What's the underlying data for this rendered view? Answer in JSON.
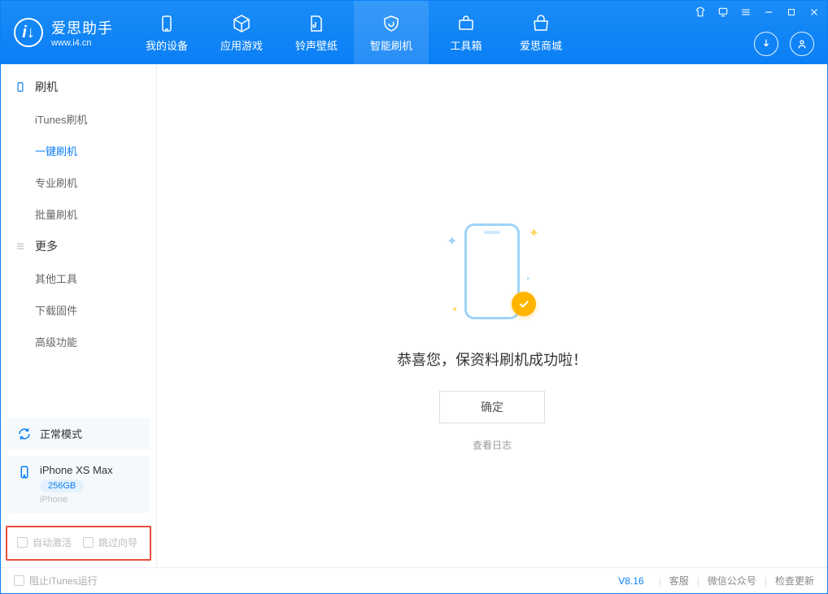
{
  "app": {
    "name": "爱思助手",
    "url": "www.i4.cn"
  },
  "topTabs": [
    {
      "label": "我的设备"
    },
    {
      "label": "应用游戏"
    },
    {
      "label": "铃声壁纸"
    },
    {
      "label": "智能刷机"
    },
    {
      "label": "工具箱"
    },
    {
      "label": "爱思商城"
    }
  ],
  "sidebar": {
    "group1": {
      "title": "刷机"
    },
    "items1": [
      {
        "label": "iTunes刷机"
      },
      {
        "label": "一键刷机"
      },
      {
        "label": "专业刷机"
      },
      {
        "label": "批量刷机"
      }
    ],
    "group2": {
      "title": "更多"
    },
    "items2": [
      {
        "label": "其他工具"
      },
      {
        "label": "下载固件"
      },
      {
        "label": "高级功能"
      }
    ]
  },
  "devices": {
    "mode": {
      "label": "正常模式"
    },
    "phone": {
      "name": "iPhone XS Max",
      "storage": "256GB",
      "type": "iPhone"
    }
  },
  "options": {
    "autoActivate": "自动激活",
    "skipGuide": "跳过向导"
  },
  "main": {
    "successText": "恭喜您，保资料刷机成功啦！",
    "okButton": "确定",
    "viewLog": "查看日志"
  },
  "footer": {
    "blockItunes": "阻止iTunes运行",
    "version": "V8.16",
    "links": [
      "客服",
      "微信公众号",
      "检查更新"
    ]
  }
}
